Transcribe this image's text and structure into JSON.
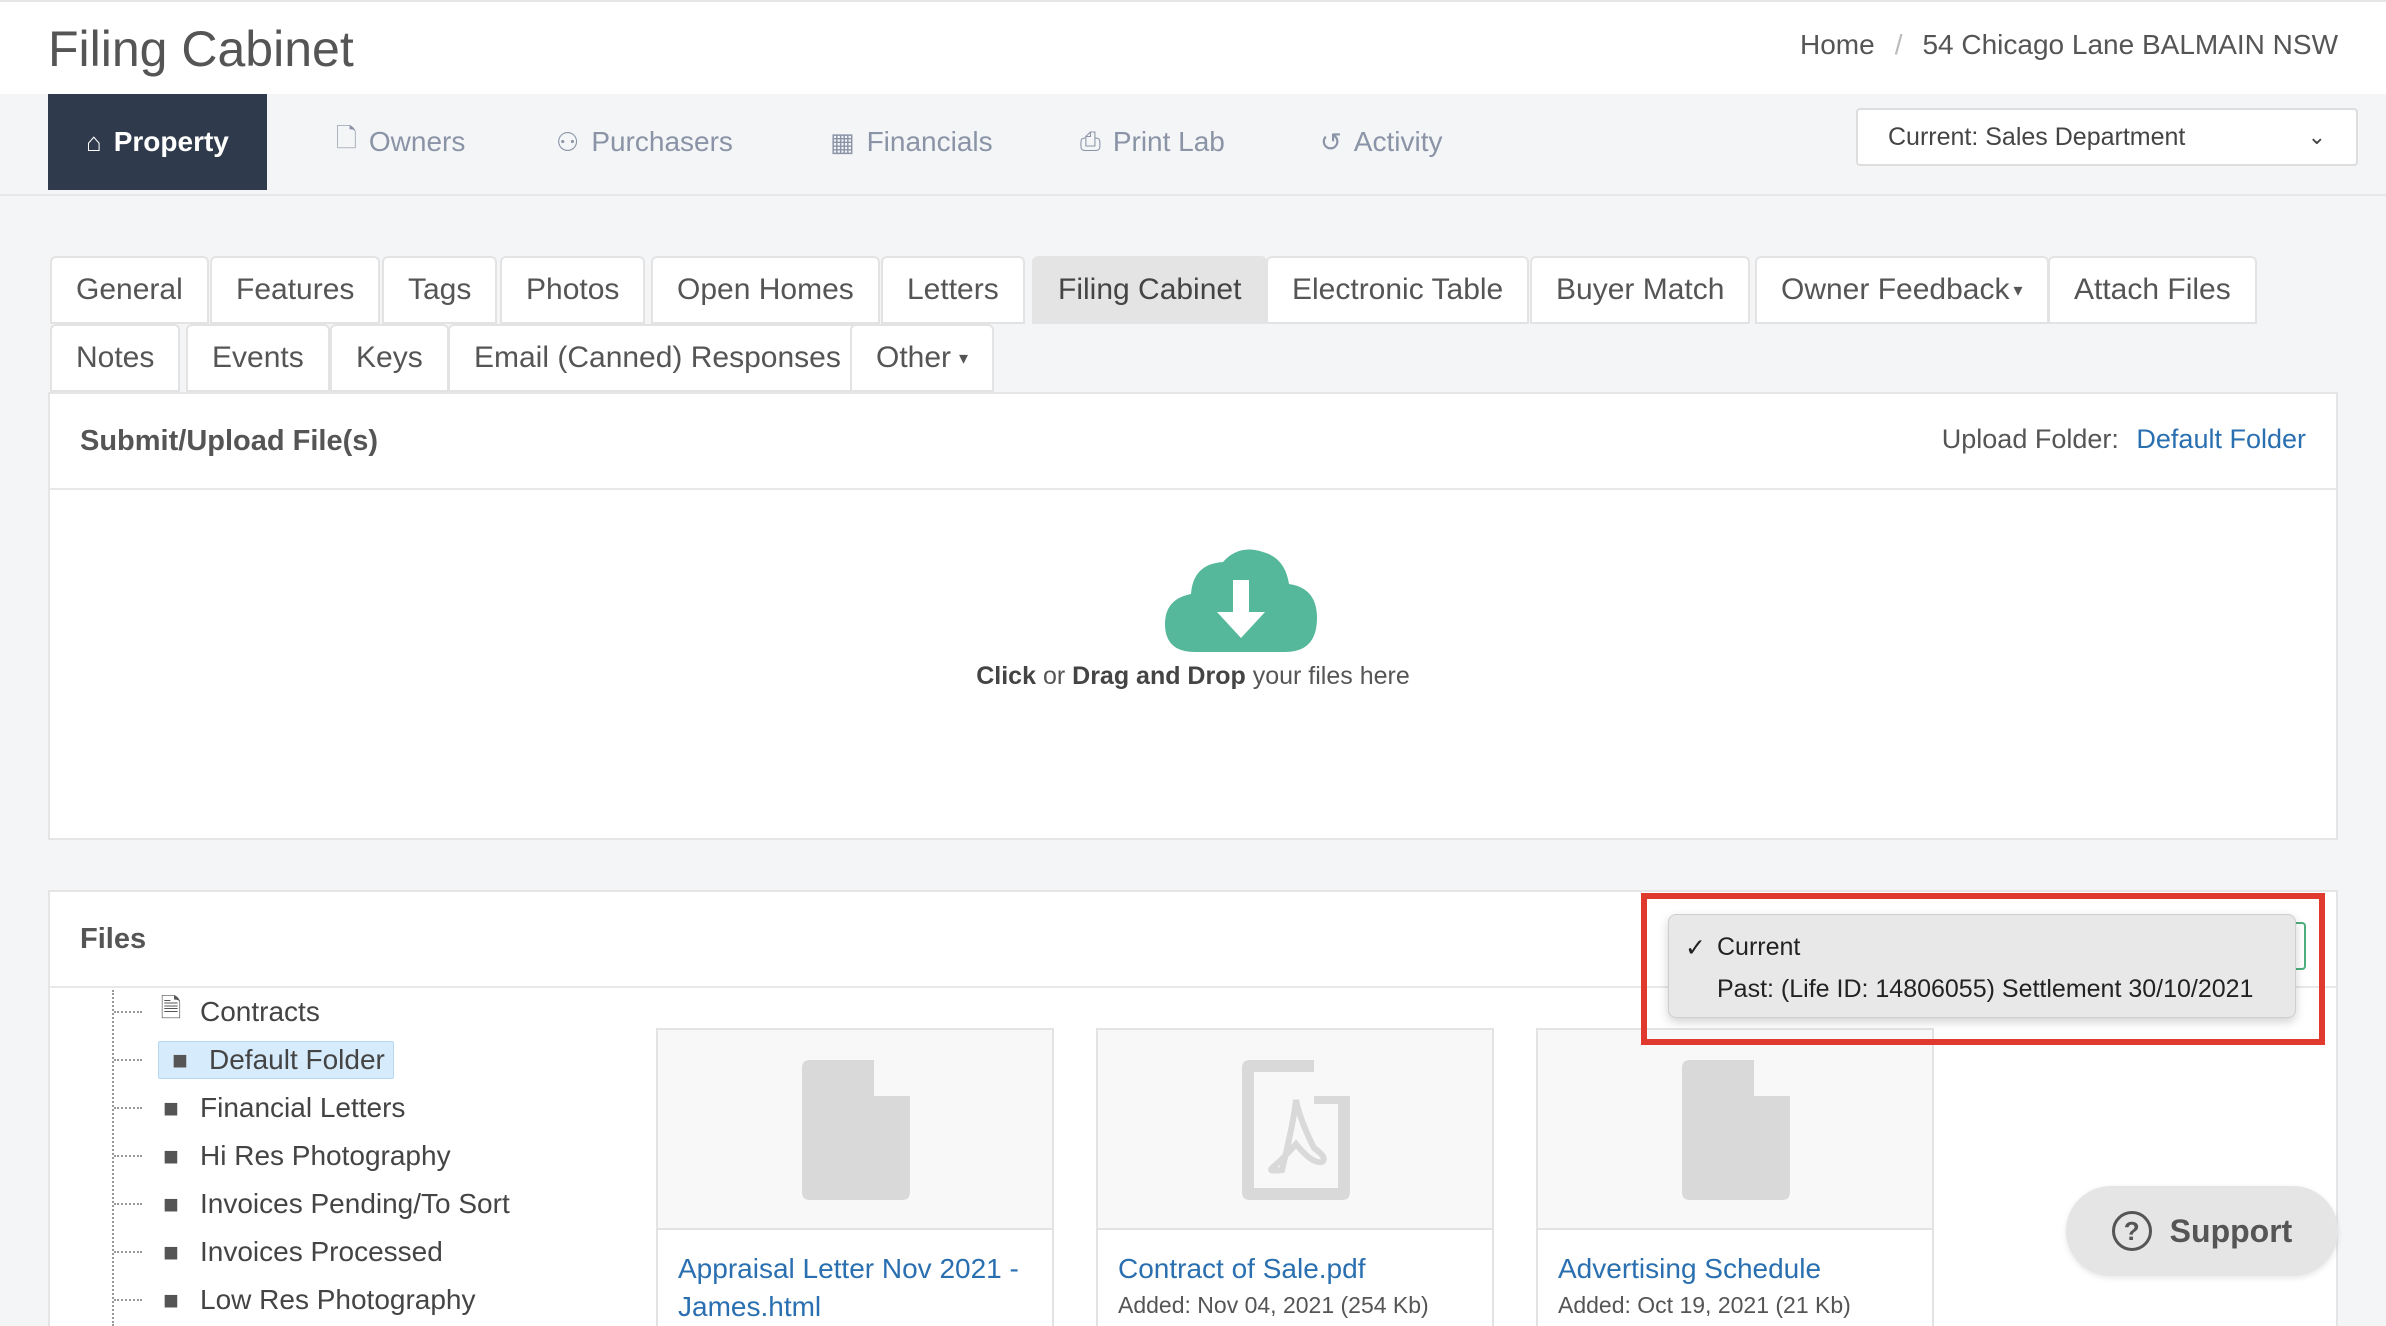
{
  "header": {
    "title": "Filing Cabinet",
    "breadcrumb": [
      "Home",
      "54 Chicago Lane BALMAIN NSW"
    ],
    "breadcrumb_sep": "/"
  },
  "main_nav": {
    "tabs": [
      {
        "label": "Property",
        "icon": "home-icon",
        "active": true
      },
      {
        "label": "Owners",
        "icon": "file-icon"
      },
      {
        "label": "Purchasers",
        "icon": "users-icon"
      },
      {
        "label": "Financials",
        "icon": "calculator-icon"
      },
      {
        "label": "Print Lab",
        "icon": "printer-icon"
      },
      {
        "label": "Activity",
        "icon": "history-icon"
      }
    ],
    "department_select": "Current: Sales Department"
  },
  "sub_tabs": {
    "row1": [
      "General",
      "Features",
      "Tags",
      "Photos",
      "Open Homes",
      "Letters",
      "Filing Cabinet",
      "Electronic Table",
      "Buyer Match",
      "Owner Feedback",
      "Attach Files"
    ],
    "row2": [
      "Notes",
      "Events",
      "Keys",
      "Email (Canned) Responses",
      "Other"
    ],
    "active": "Filing Cabinet"
  },
  "upload": {
    "title": "Submit/Upload File(s)",
    "folder_label": "Upload Folder:",
    "folder_value": "Default Folder",
    "drop_click": "Click",
    "drop_or": "or",
    "drop_drag": "Drag and Drop",
    "drop_rest": "your files here"
  },
  "files": {
    "title": "Files",
    "lifecycle_options": [
      {
        "label": "Current",
        "checked": true
      },
      {
        "label": "Past: (Life ID: 14806055) Settlement 30/10/2021",
        "checked": false
      }
    ],
    "folders": [
      {
        "label": "Contracts",
        "icon": "contract-file-icon"
      },
      {
        "label": "Default Folder",
        "icon": "folder-icon",
        "selected": true
      },
      {
        "label": "Financial Letters",
        "icon": "folder-icon"
      },
      {
        "label": "Hi Res Photography",
        "icon": "folder-icon"
      },
      {
        "label": "Invoices Pending/To Sort",
        "icon": "folder-icon"
      },
      {
        "label": "Invoices Processed",
        "icon": "folder-icon"
      },
      {
        "label": "Low Res Photography",
        "icon": "folder-icon"
      }
    ],
    "cards": [
      {
        "name": "Appraisal Letter Nov 2021 - James.html",
        "meta": "",
        "icon": "document-icon"
      },
      {
        "name": "Contract of Sale.pdf",
        "meta": "Added: Nov 04, 2021 (254 Kb)",
        "icon": "pdf-icon"
      },
      {
        "name": "Advertising Schedule",
        "meta": "Added: Oct 19, 2021 (21 Kb)",
        "icon": "document-icon"
      }
    ]
  },
  "support": {
    "label": "Support",
    "q": "?"
  },
  "colors": {
    "nav_active_bg": "#2f3b4c",
    "link": "#2a6fb0",
    "cloud": "#55b89a",
    "highlight": "#e03a2f"
  }
}
